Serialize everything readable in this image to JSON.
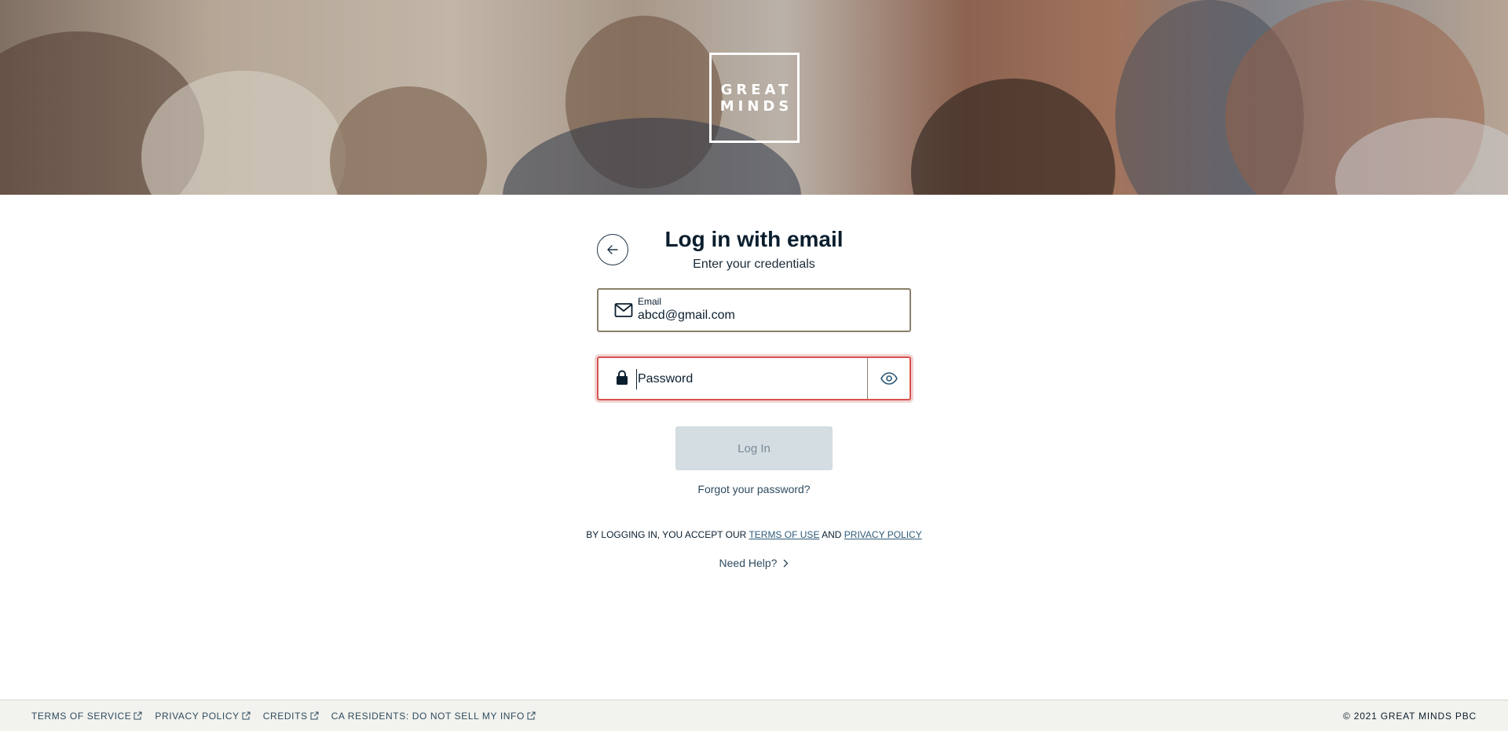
{
  "logo": {
    "line1": "GREAT",
    "line2": "MINDS"
  },
  "login": {
    "title": "Log in with email",
    "subtitle": "Enter your credentials",
    "email_label": "Email",
    "email_value": "abcd@gmail.com",
    "password_placeholder": "Password",
    "submit_label": "Log In",
    "forgot_label": "Forgot your password?"
  },
  "legal": {
    "prefix": "BY LOGGING IN, YOU ACCEPT OUR ",
    "terms_label": "TERMS OF USE",
    "and": " AND ",
    "privacy_label": "PRIVACY POLICY"
  },
  "help": {
    "label": "Need Help?"
  },
  "footer": {
    "links": [
      "TERMS OF SERVICE",
      "PRIVACY POLICY",
      "CREDITS",
      "CA RESIDENTS: DO NOT SELL MY INFO"
    ],
    "copyright": "© 2021 GREAT MINDS PBC"
  },
  "colors": {
    "error": "#d9534f",
    "disabled_button": "#d3dde2",
    "footer_bg": "#f2f2ee",
    "link": "#2e4b5e"
  },
  "icons": [
    "arrow-left-icon",
    "mail-icon",
    "lock-icon",
    "eye-icon",
    "chevron-right-icon",
    "external-link-icon"
  ]
}
